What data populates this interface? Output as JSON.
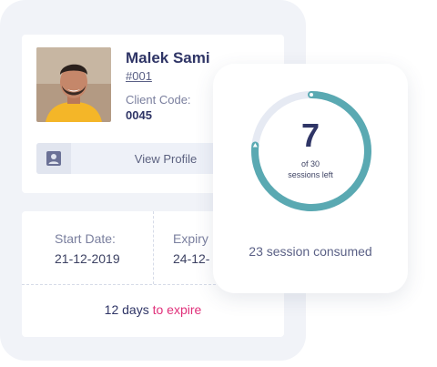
{
  "client": {
    "name": "Malek Sami",
    "id": "#001",
    "code_label": "Client Code:",
    "code_value": "0045",
    "view_profile_label": "View Profile"
  },
  "dates": {
    "start_label": "Start Date:",
    "start_value": "21-12-2019",
    "expiry_label": "Expiry",
    "expiry_value": "24-12-"
  },
  "expiry_notice": {
    "count": "12 days",
    "suffix": "to expire"
  },
  "sessions": {
    "left": "7",
    "left_caption_1": "of 30",
    "left_caption_2": "sessions left",
    "consumed_text": "23 session consumed",
    "left_value": 7,
    "total": 30
  },
  "colors": {
    "ring_progress": "#5aa9b2",
    "ring_track": "#e6eaf3",
    "accent_pink": "#e0307a",
    "title_navy": "#2f3566"
  }
}
